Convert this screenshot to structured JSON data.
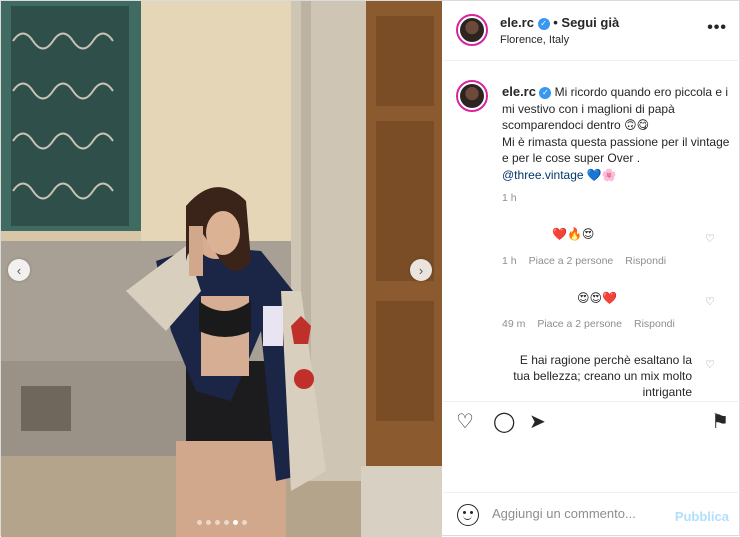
{
  "photo": {
    "left_arrow": "‹",
    "right_arrow": "›",
    "dots_total": 6,
    "dots_active_index": 4
  },
  "header": {
    "username": "ele.rc",
    "verified_glyph": "✓",
    "follow_label": "• Segui già",
    "location": "Florence, Italy",
    "more_glyph": "•••"
  },
  "caption": {
    "username": "ele.rc",
    "text_line1": "Mi ricordo quando ero piccola e i mi vestivo con i maglioni di papà scomparendoci dentro 🙃😋",
    "text_line2": "Mi è rimasta questa passione per il vintage e per le cose super Over .",
    "mention": "@three.vintage",
    "emojis": "💙🌸",
    "time": "1 h"
  },
  "comments": [
    {
      "text": "❤️🔥😍",
      "time": "1 h",
      "likes": "Piace a 2 persone",
      "reply": "Rispondi"
    },
    {
      "text": "😍😍❤️",
      "time": "49 m",
      "likes": "Piace a 2 persone",
      "reply": "Rispondi"
    },
    {
      "text": "E hai ragione perchè esaltano la tua bellezza; creano un mix molto intrigante"
    }
  ],
  "actions": {
    "like_icon": "♡",
    "comment_icon": "◯",
    "share_icon": "➤",
    "save_icon": "⚑"
  },
  "add_comment": {
    "placeholder": "Aggiungi un commento...",
    "publish_label": "Pubblica"
  }
}
